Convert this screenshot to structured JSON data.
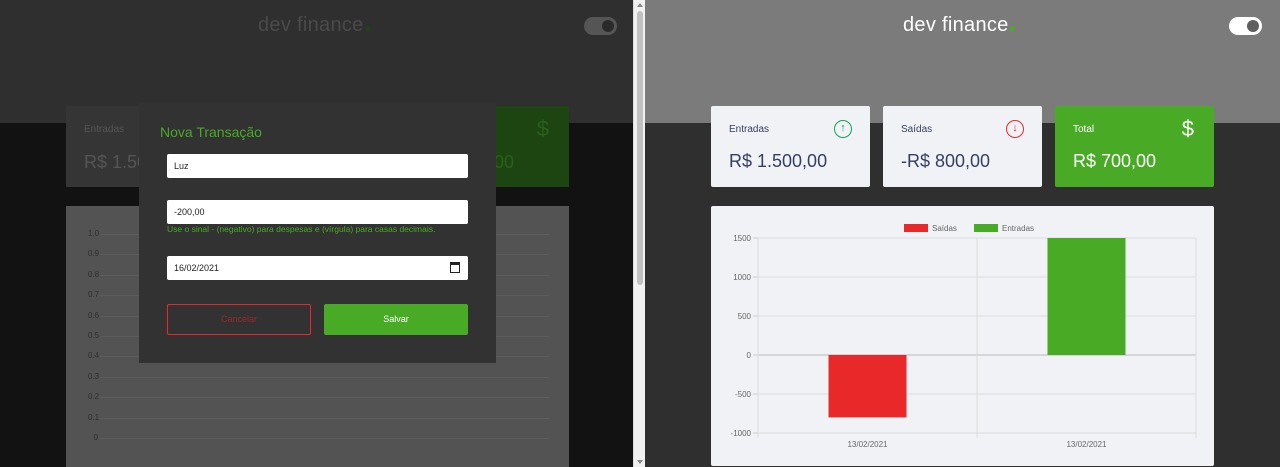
{
  "app": {
    "logo_text": "dev finance"
  },
  "colors": {
    "accent_green": "#49aa26",
    "red": "#e92929",
    "up_green": "#12a454",
    "text_dark": "#363f5f"
  },
  "background_view": {
    "cards": {
      "income_label": "Entradas",
      "income_value": "R$ 1.50",
      "total_value_fragment": "00"
    },
    "chart_ticks": [
      "1.0",
      "0.9",
      "0.8",
      "0.7",
      "0.6",
      "0.5",
      "0.4",
      "0.3",
      "0.2",
      "0.1",
      "0"
    ]
  },
  "modal": {
    "title": "Nova Transação",
    "description_value": "Luz",
    "amount_value": "-200,00",
    "help_text": "Use o sinal - (negativo) para despesas e (vírgula) para casas decimais.",
    "date_value": "16/02/2021",
    "cancel_label": "Cancelar",
    "save_label": "Salvar"
  },
  "summary": {
    "income_label": "Entradas",
    "income_value": "R$ 1.500,00",
    "expense_label": "Saídas",
    "expense_value": "-R$ 800,00",
    "total_label": "Total",
    "total_value": "R$ 700,00",
    "icons": {
      "income": "arrow-up-circle-icon",
      "expense": "arrow-down-circle-icon",
      "total": "dollar-icon"
    }
  },
  "chart_data": {
    "type": "bar",
    "categories": [
      "13/02/2021",
      "13/02/2021"
    ],
    "series": [
      {
        "name": "Saídas",
        "color": "#e92929",
        "values": [
          -800,
          null
        ]
      },
      {
        "name": "Entradas",
        "color": "#49aa26",
        "values": [
          null,
          1500
        ]
      }
    ],
    "yticks": [
      1500,
      1000,
      500,
      0,
      -500,
      -1000
    ],
    "ylim": [
      -1000,
      1500
    ],
    "grid": true,
    "legend_position": "top-center"
  }
}
